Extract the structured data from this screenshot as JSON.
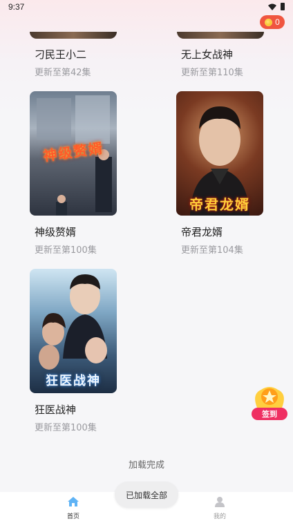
{
  "status_bar": {
    "time": "9:37"
  },
  "coin_badge": {
    "count": "0"
  },
  "cards": [
    {
      "title": "刁民王小二",
      "subtitle": "更新至第42集"
    },
    {
      "title": "无上女战神",
      "subtitle": "更新至第110集"
    },
    {
      "title": "神级赘婿",
      "subtitle": "更新至第100集",
      "poster_text": "神级赘婿"
    },
    {
      "title": "帝君龙婿",
      "subtitle": "更新至第104集",
      "poster_text": "帝君龙婿"
    },
    {
      "title": "狂医战神",
      "subtitle": "更新至第100集",
      "poster_text": "狂医战神"
    }
  ],
  "load_status": "加载完成",
  "toast": "已加载全部",
  "checkin": {
    "label": "签到"
  },
  "bottom_nav": {
    "home": "首页",
    "mine": "我的"
  },
  "colors": {
    "accent_red": "#f0553f",
    "checkin_pink": "#ef2f62",
    "home_icon": "#5fb3f5"
  },
  "icons": [
    "wifi-icon",
    "battery-icon",
    "coin-icon",
    "home-icon",
    "user-icon",
    "star-icon"
  ]
}
